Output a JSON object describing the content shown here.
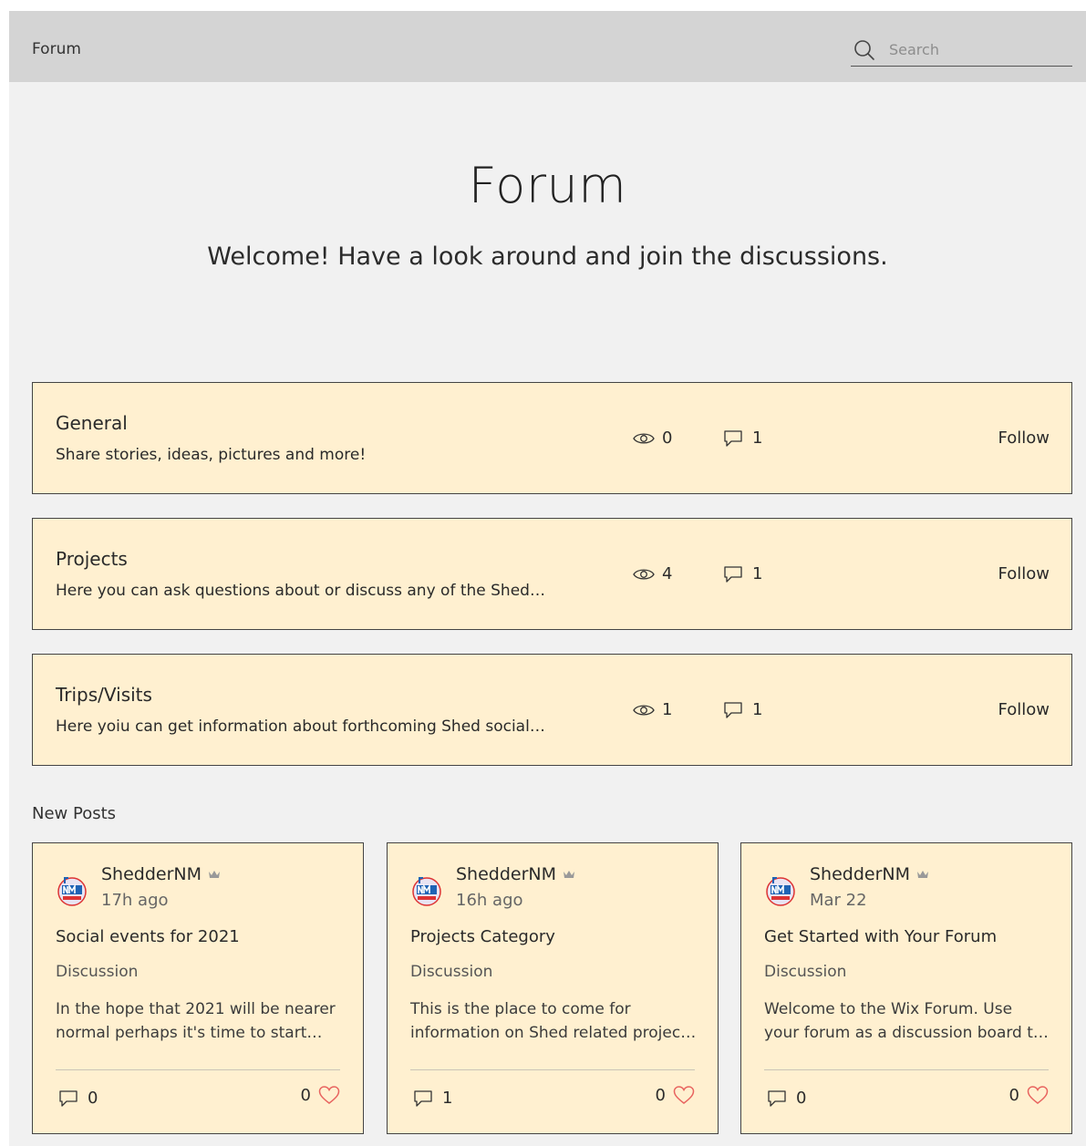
{
  "header": {
    "brand": "Forum",
    "search_placeholder": "Search"
  },
  "hero": {
    "title": "Forum",
    "subtitle": "Welcome! Have a look around and join the discussions."
  },
  "categories": [
    {
      "name": "General",
      "description": "Share stories, ideas, pictures and more!",
      "views": "0",
      "comments": "1",
      "follow_label": "Follow"
    },
    {
      "name": "Projects",
      "description": "Here you can ask questions about or discuss any of the Shed…",
      "views": "4",
      "comments": "1",
      "follow_label": "Follow"
    },
    {
      "name": "Trips/Visits",
      "description": "Here yoiu can get information about forthcoming Shed social…",
      "views": "1",
      "comments": "1",
      "follow_label": "Follow"
    }
  ],
  "new_posts": {
    "title": "New Posts",
    "posts": [
      {
        "author": "ShedderNM",
        "time": "17h ago",
        "title": "Social events for 2021",
        "category": "Discussion",
        "excerpt": "In the hope that 2021 will be nearer normal perhaps it's time to start…",
        "comments": "0",
        "likes": "0"
      },
      {
        "author": "ShedderNM",
        "time": "16h ago",
        "title": "Projects Category",
        "category": "Discussion",
        "excerpt": "This is the place to come for information on Shed related projec…",
        "comments": "1",
        "likes": "0"
      },
      {
        "author": "ShedderNM",
        "time": "Mar 22",
        "title": "Get Started with Your Forum",
        "category": "Discussion",
        "excerpt": "Welcome to the Wix Forum. Use your forum as a discussion board t…",
        "comments": "0",
        "likes": "0"
      }
    ]
  },
  "icons": {
    "search": "search-icon",
    "views": "eye-icon",
    "comments": "comment-icon",
    "like": "heart-icon",
    "admin": "crown-icon",
    "avatar": "nm-logo-avatar"
  },
  "colors": {
    "topbar": "#d4d4d4",
    "page_bg": "#f1f1f1",
    "card_bg": "#fff0d0",
    "card_border": "#444444",
    "heart": "#e8635f"
  }
}
